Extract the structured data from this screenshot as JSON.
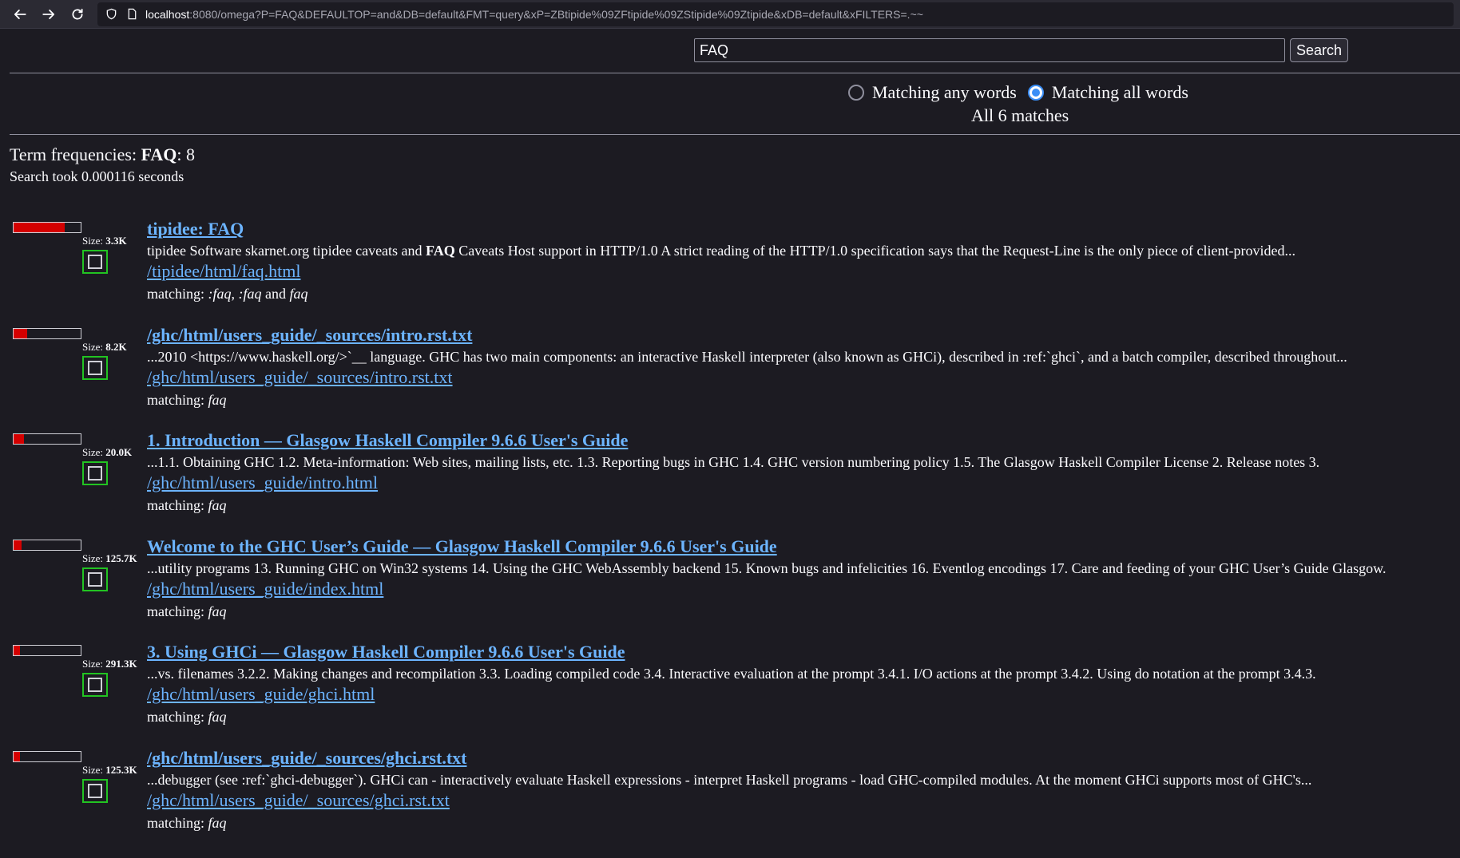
{
  "browser": {
    "url_host": "localhost",
    "url_rest": ":8080/omega?P=FAQ&DEFAULTOP=and&DB=default&FMT=query&xP=ZBtipide%09ZFtipide%09ZStipide%09Ztipide&xDB=default&xFILTERS=.~~"
  },
  "search": {
    "value": "FAQ",
    "button_label": "Search"
  },
  "match_mode": {
    "any_label": "Matching any words",
    "all_label": "Matching all words",
    "selected": "all"
  },
  "match_count": "All 6 matches",
  "term_freq": {
    "label": "Term frequencies: ",
    "term": "FAQ",
    "sep": ": ",
    "count": "8"
  },
  "search_time": "Search took 0.000116 seconds",
  "results": [
    {
      "title": "tipidee: FAQ",
      "relevance": 0.76,
      "size_label": "Size: ",
      "size": "3.3K",
      "snippet_pre": "tipidee Software skarnet.org tipidee caveats and ",
      "snippet_bold": "FAQ",
      "snippet_post": " Caveats Host support in HTTP/1.0 A strict reading of the HTTP/1.0 specification says that the Request-Line is the only piece of client-provided...",
      "path": "/tipidee/html/faq.html",
      "matching_label": "matching: ",
      "matching_terms": [
        ":faq",
        ":faq",
        "faq"
      ],
      "matching_sep1": ", ",
      "matching_sep2": " and "
    },
    {
      "title": "/ghc/html/users_guide/_sources/intro.rst.txt",
      "relevance": 0.2,
      "size_label": "Size: ",
      "size": "8.2K",
      "snippet_pre": "...2010 <https://www.haskell.org/>`__ language. GHC has two main components: an interactive Haskell interpreter (also known as GHCi), described in :ref:`ghci`, and a batch compiler, described throughout...",
      "snippet_bold": "",
      "snippet_post": "",
      "path": "/ghc/html/users_guide/_sources/intro.rst.txt",
      "matching_label": "matching: ",
      "matching_terms": [
        "faq"
      ]
    },
    {
      "title": "1. Introduction — Glasgow Haskell Compiler 9.6.6 User's Guide",
      "relevance": 0.15,
      "size_label": "Size: ",
      "size": "20.0K",
      "snippet_pre": "...1.1. Obtaining GHC 1.2. Meta-information: Web sites, mailing lists, etc. 1.3. Reporting bugs in GHC 1.4. GHC version numbering policy 1.5. The Glasgow Haskell Compiler License 2. Release notes 3.",
      "snippet_bold": "",
      "snippet_post": "",
      "path": "/ghc/html/users_guide/intro.html",
      "matching_label": "matching: ",
      "matching_terms": [
        "faq"
      ]
    },
    {
      "title": "Welcome to the GHC User’s Guide — Glasgow Haskell Compiler 9.6.6 User's Guide",
      "relevance": 0.12,
      "size_label": "Size: ",
      "size": "125.7K",
      "snippet_pre": "...utility programs 13. Running GHC on Win32 systems 14. Using the GHC WebAssembly backend 15. Known bugs and infelicities 16. Eventlog encodings 17. Care and feeding of your GHC User’s Guide Glasgow.",
      "snippet_bold": "",
      "snippet_post": "",
      "path": "/ghc/html/users_guide/index.html",
      "matching_label": "matching: ",
      "matching_terms": [
        "faq"
      ]
    },
    {
      "title": "3. Using GHCi — Glasgow Haskell Compiler 9.6.6 User's Guide",
      "relevance": 0.1,
      "size_label": "Size: ",
      "size": "291.3K",
      "snippet_pre": "...vs. filenames 3.2.2. Making changes and recompilation 3.3. Loading compiled code 3.4. Interactive evaluation at the prompt 3.4.1. I/O actions at the prompt 3.4.2. Using do notation at the prompt 3.4.3.",
      "snippet_bold": "",
      "snippet_post": "",
      "path": "/ghc/html/users_guide/ghci.html",
      "matching_label": "matching: ",
      "matching_terms": [
        "faq"
      ]
    },
    {
      "title": "/ghc/html/users_guide/_sources/ghci.rst.txt",
      "relevance": 0.1,
      "size_label": "Size: ",
      "size": "125.3K",
      "snippet_pre": "...debugger (see :ref:`ghci-debugger`). GHCi can - interactively evaluate Haskell expressions - interpret Haskell programs - load GHC-compiled modules. At the moment GHCi supports most of GHC's...",
      "snippet_bold": "",
      "snippet_post": "",
      "path": "/ghc/html/users_guide/_sources/ghci.rst.txt",
      "matching_label": "matching: ",
      "matching_terms": [
        "faq"
      ]
    }
  ]
}
